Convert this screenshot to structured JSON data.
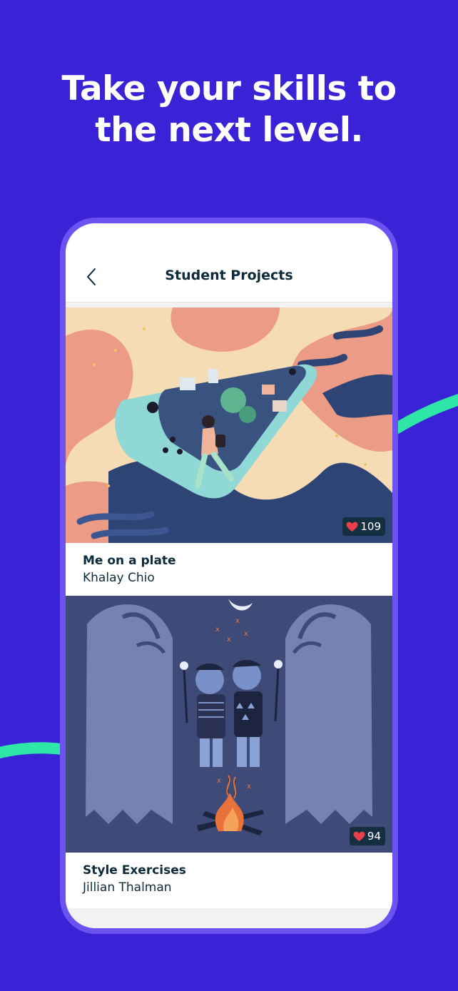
{
  "headline": {
    "line1": "Take your skills to",
    "line2": "the next level."
  },
  "colors": {
    "background": "#3a23d6",
    "phone_frame": "#6d52f2",
    "accent_line": "#2ee6a6",
    "text_dark": "#0d2a3a",
    "like_badge": "#143040",
    "heart": "#e8404a"
  },
  "navbar": {
    "title": "Student Projects",
    "back_icon": "chevron-left-icon"
  },
  "projects": [
    {
      "title": "Me on a plate",
      "author": "Khalay Chio",
      "likes": "109",
      "like_icon": "heart-icon"
    },
    {
      "title": "Style Exercises",
      "author": "Jillian Thalman",
      "likes": "94",
      "like_icon": "heart-icon"
    }
  ]
}
